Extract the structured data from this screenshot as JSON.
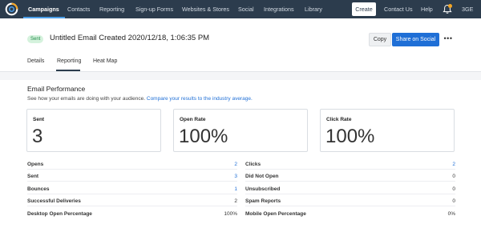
{
  "nav": {
    "items": [
      "Campaigns",
      "Contacts",
      "Reporting",
      "Sign-up Forms",
      "Websites & Stores",
      "Social",
      "Integrations",
      "Library"
    ],
    "create_label": "Create",
    "contact_us": "Contact Us",
    "help": "Help",
    "account": "3GE",
    "icons": {
      "logo": "constant-contact-logo",
      "bell": "notification-bell-icon"
    },
    "colors": {
      "background": "#2c3c4d",
      "active_underline": "#4a9ee8",
      "bell_dot": "#f5a623"
    }
  },
  "header": {
    "status_badge": "Sent",
    "title": "Untitled Email Created 2020/12/18, 1:06:35 PM",
    "copy_label": "Copy",
    "share_label": "Share on Social",
    "more_label": "•••"
  },
  "tabs": [
    "Details",
    "Reporting",
    "Heat Map"
  ],
  "active_tab": "Reporting",
  "performance": {
    "title": "Email Performance",
    "description": "See how your emails are doing with your audience.",
    "link_text": "Compare your results to the industry average."
  },
  "cards": [
    {
      "label": "Sent",
      "value": "3"
    },
    {
      "label": "Open Rate",
      "value": "100%"
    },
    {
      "label": "Click Rate",
      "value": "100%"
    }
  ],
  "stats_left": [
    {
      "label": "Opens",
      "value": "2",
      "link": true
    },
    {
      "label": "Sent",
      "value": "3",
      "link": true
    },
    {
      "label": "Bounces",
      "value": "1",
      "link": true
    },
    {
      "label": "Successful Deliveries",
      "value": "2",
      "link": false
    },
    {
      "label": "Desktop Open Percentage",
      "value": "100%",
      "link": false
    }
  ],
  "stats_right": [
    {
      "label": "Clicks",
      "value": "2",
      "link": true
    },
    {
      "label": "Did Not Open",
      "value": "0",
      "link": false
    },
    {
      "label": "Unsubscribed",
      "value": "0",
      "link": false
    },
    {
      "label": "Spam Reports",
      "value": "0",
      "link": false
    },
    {
      "label": "Mobile Open Percentage",
      "value": "0%",
      "link": false
    }
  ],
  "colors": {
    "primary": "#1f6fd6",
    "badge_bg": "#d5f2dd",
    "badge_text": "#1f8a48"
  }
}
